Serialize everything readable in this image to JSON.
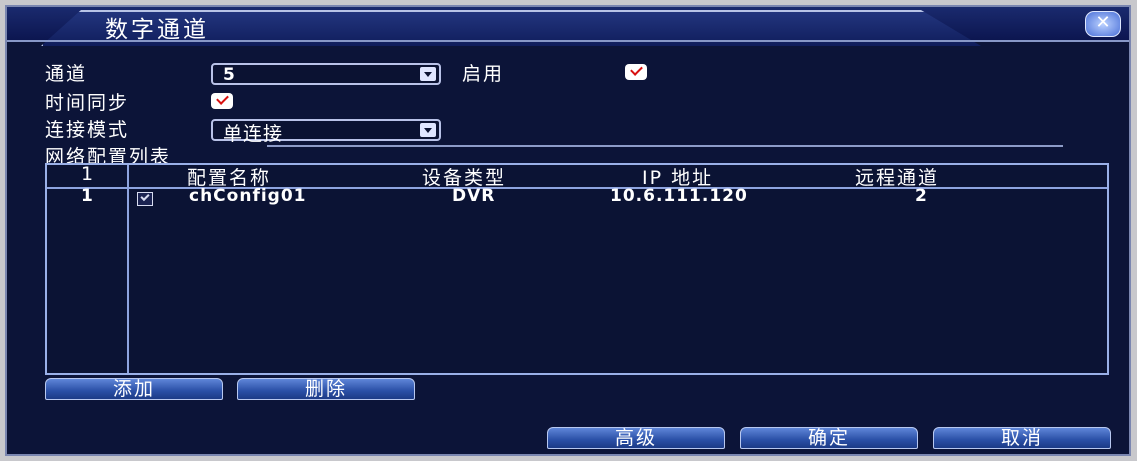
{
  "window": {
    "title": "数字通道",
    "close_label": "✕"
  },
  "form": {
    "channel_label": "通道",
    "channel_value": "5",
    "enable_label": "启用",
    "enable_checked": true,
    "time_sync_label": "时间同步",
    "time_sync_checked": true,
    "connect_mode_label": "连接模式",
    "connect_mode_value": "单连接"
  },
  "network_list": {
    "section_label": "网络配置列表",
    "headers": [
      "1",
      "配置名称",
      "设备类型",
      "IP 地址",
      "远程通道"
    ],
    "rows": [
      {
        "index": "1",
        "checked": true,
        "config_name": "chConfig01",
        "device_type": "DVR",
        "ip": "10.6.111.120",
        "remote_channel": "2"
      }
    ]
  },
  "buttons": {
    "add": "添加",
    "delete": "删除",
    "advanced": "高级",
    "ok": "确定",
    "cancel": "取消"
  },
  "colors": {
    "background": "#0c1438",
    "accent": "#2a4fa6",
    "check_mark": "#d81010"
  }
}
